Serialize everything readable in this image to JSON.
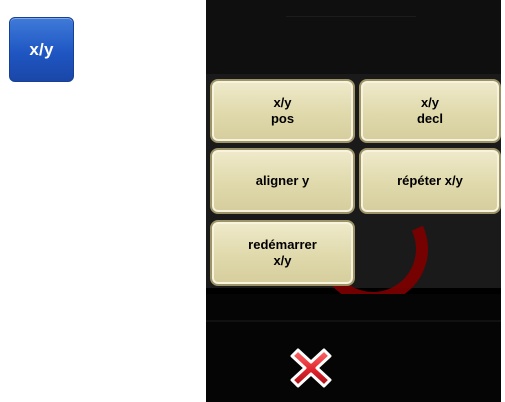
{
  "left_icon": {
    "label": "x/y",
    "icon": "xy-icon"
  },
  "menu": {
    "buttons": [
      {
        "id": "pos",
        "label": "x/y\npos"
      },
      {
        "id": "decl",
        "label": "x/y\ndecl"
      },
      {
        "id": "align",
        "label": "aligner y"
      },
      {
        "id": "repeat",
        "label": "répéter x/y"
      },
      {
        "id": "restart",
        "label": "redémarrer\nx/y"
      }
    ]
  },
  "close": {
    "icon": "close-icon"
  },
  "colors": {
    "icon_blue": "#1f56c2",
    "button_face": "#e0d9ac",
    "close_red": "#e0262e",
    "screen_bg": "#000000"
  }
}
